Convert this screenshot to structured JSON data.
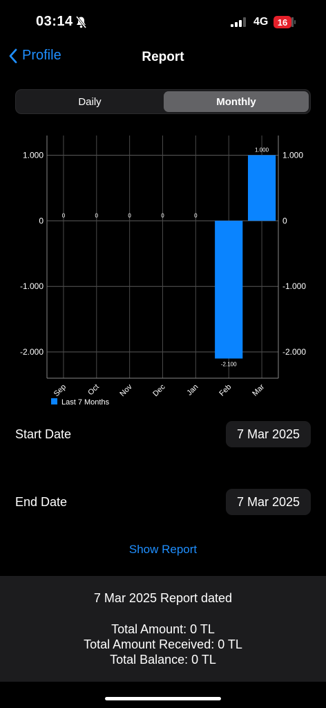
{
  "status": {
    "time": "03:14",
    "network": "4G",
    "battery": "16"
  },
  "nav": {
    "back_label": "Profile",
    "title": "Report"
  },
  "segments": {
    "daily": "Daily",
    "monthly": "Monthly",
    "selected": "Monthly"
  },
  "chart_data": {
    "type": "bar",
    "categories": [
      "Sep",
      "Oct",
      "Nov",
      "Dec",
      "Jan",
      "Feb",
      "Mar"
    ],
    "series": [
      {
        "name": "Last 7 Months",
        "values": [
          0,
          0,
          0,
          0,
          0,
          -2100,
          1000
        ],
        "color": "#0a84ff"
      }
    ],
    "data_labels": [
      "0",
      "0",
      "0",
      "0",
      "0",
      "-2.100",
      "1.000"
    ],
    "y_ticks": [
      1000,
      0,
      -1000,
      -2000
    ],
    "y_tick_labels": [
      "1.000",
      "0",
      "-1.000",
      "-2.000"
    ],
    "ylim": [
      -2400,
      1300
    ],
    "grid": true,
    "legend": "bottom-left",
    "title": "",
    "xlabel": "",
    "ylabel": ""
  },
  "form": {
    "start_label": "Start Date",
    "start_value": "7 Mar 2025",
    "end_label": "End Date",
    "end_value": "7 Mar 2025",
    "show_report": "Show Report"
  },
  "summary": {
    "title": "7 Mar 2025 Report dated",
    "total_amount": "Total Amount: 0 TL",
    "total_received": "Total Amount Received: 0 TL",
    "total_balance": "Total Balance: 0 TL"
  },
  "colors": {
    "accent": "#1f8fff",
    "bar": "#0a84ff",
    "battery": "#e5202a"
  }
}
